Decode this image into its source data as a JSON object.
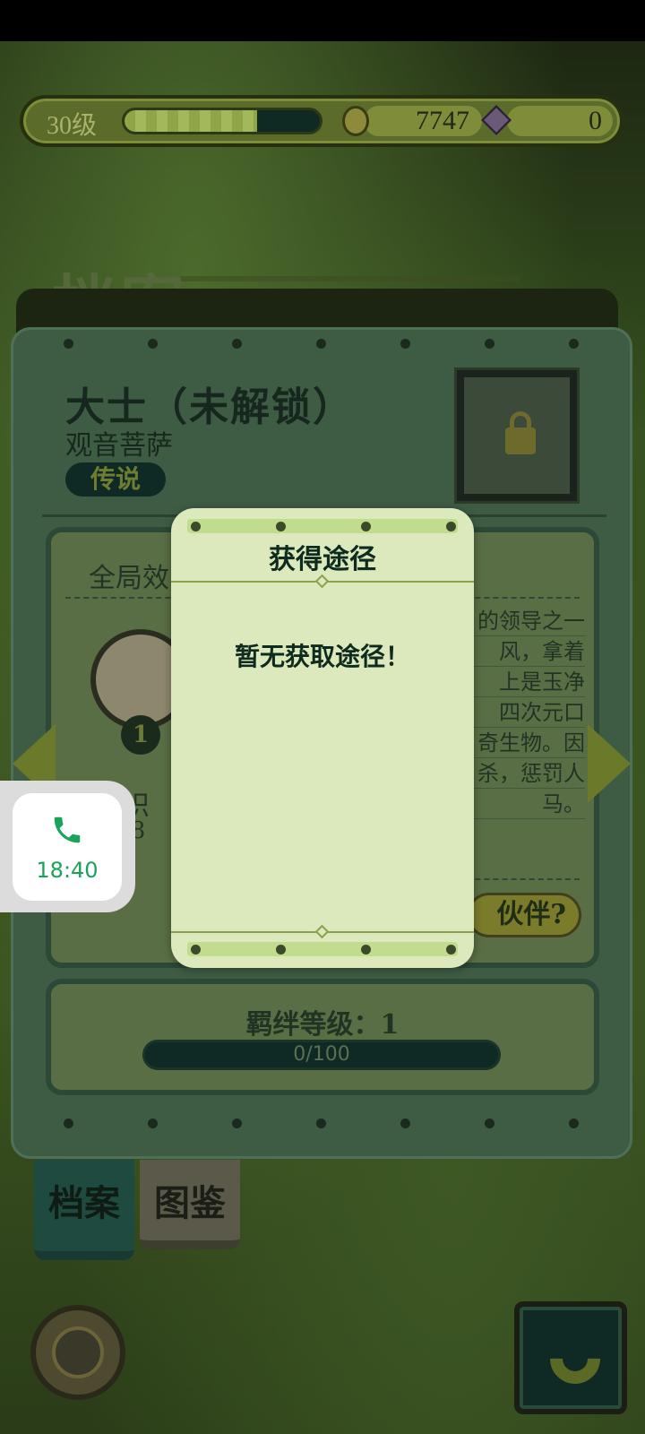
{
  "topbar": {
    "level": "30级",
    "xp_progress": 0.68,
    "coins": "7747",
    "gems": "0"
  },
  "archive_heading": "档案",
  "character": {
    "name": "大士（未解锁）",
    "subtitle": "观音菩萨",
    "rarity": "传说"
  },
  "global_effect_label": "全局效",
  "goat_level": "1",
  "left_info": {
    "line1": "识",
    "line2": "-8"
  },
  "description_lines": [
    "的领导之一",
    "风，拿着",
    "上是玉净",
    "四次元口",
    "奇生物。因",
    "杀，惩罚人",
    "马。"
  ],
  "partner_button": "伙伴?",
  "bond": {
    "label": "羁绊等级：1",
    "progress_text": "0/100"
  },
  "tabs": {
    "archive": "档案",
    "atlas": "图鉴"
  },
  "modal": {
    "title": "获得途径",
    "message": "暂无获取途径！"
  },
  "call": {
    "time": "18:40",
    "icon": "phone-icon",
    "color": "#1aa35a"
  },
  "colors": {
    "modal_bg": "#dce9bc",
    "panel_bg": "#3e5c44"
  }
}
